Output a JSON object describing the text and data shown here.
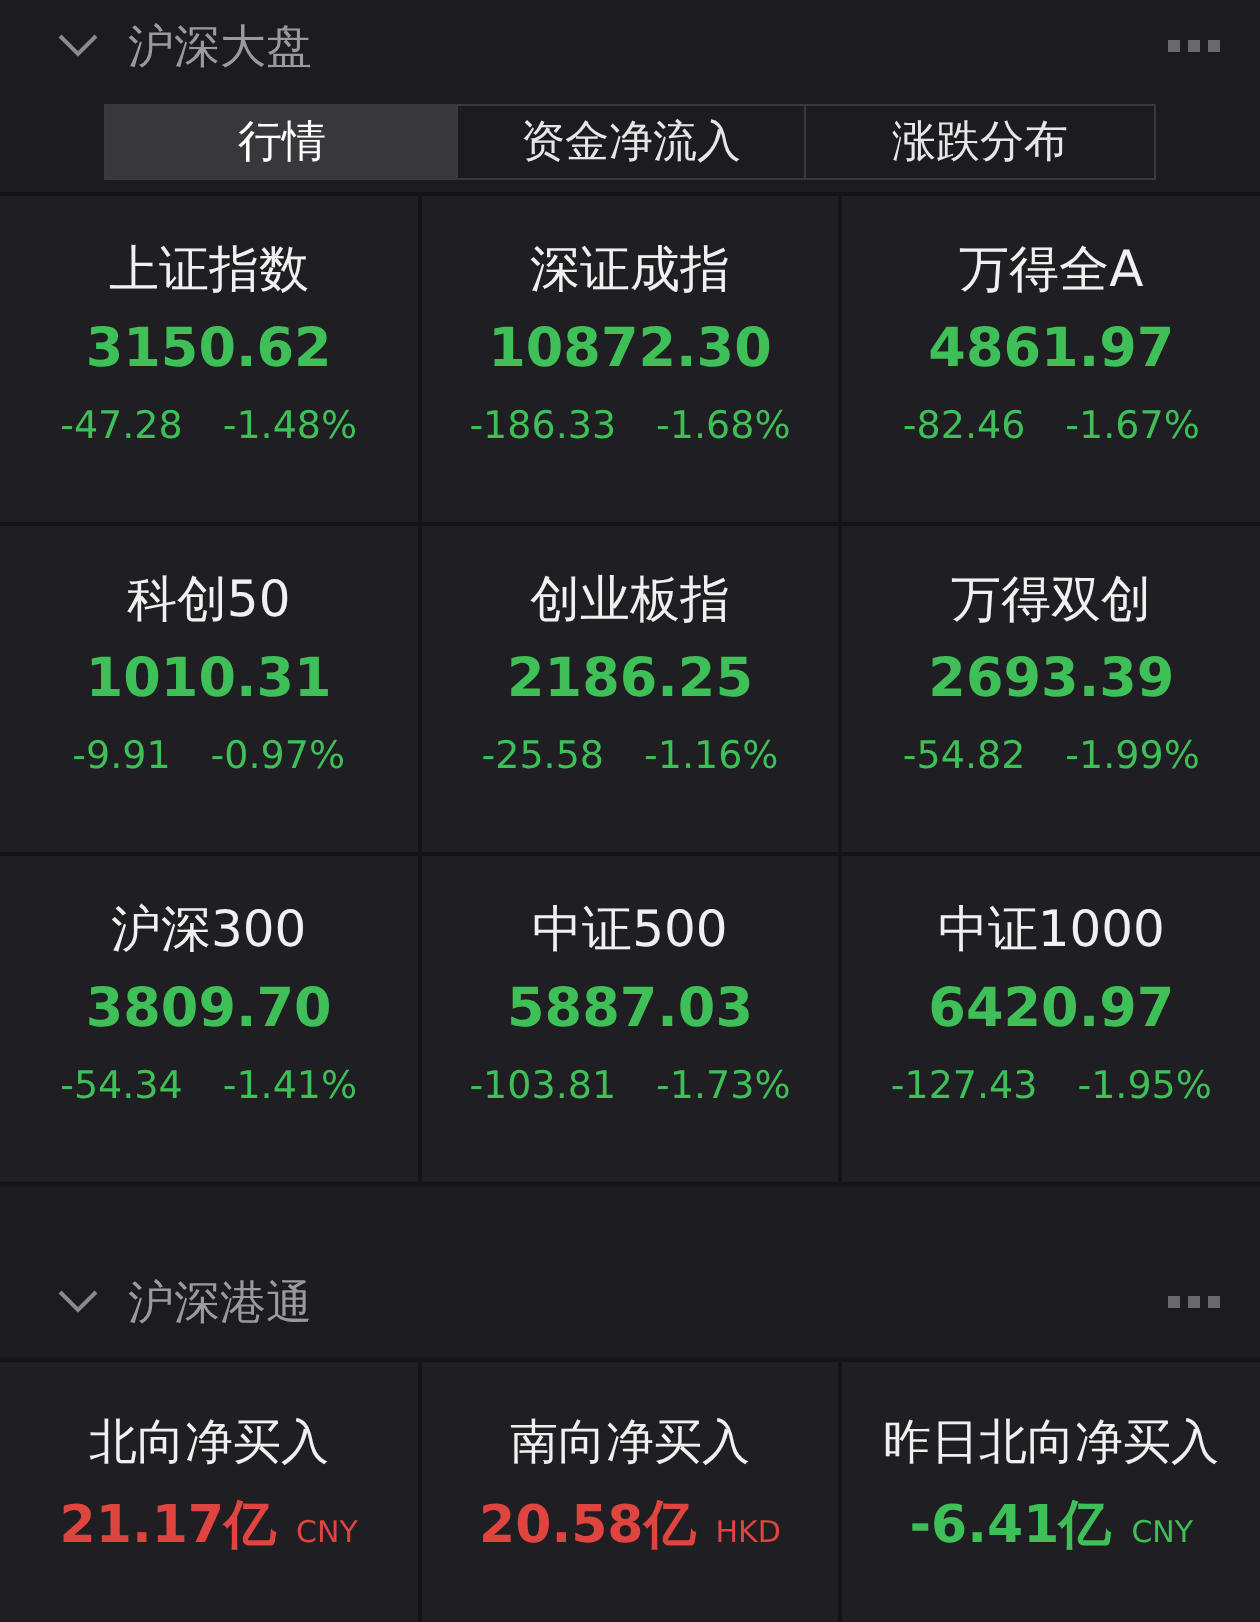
{
  "sections": [
    {
      "title": "沪深大盘",
      "expanded": true,
      "tabs": [
        {
          "label": "行情",
          "selected": true
        },
        {
          "label": "资金净流入",
          "selected": false
        },
        {
          "label": "涨跌分布",
          "selected": false
        }
      ],
      "indices": [
        {
          "name": "上证指数",
          "value": "3150.62",
          "change": "-47.28",
          "percent": "-1.48%",
          "color": "#3fbf57"
        },
        {
          "name": "深证成指",
          "value": "10872.30",
          "change": "-186.33",
          "percent": "-1.68%",
          "color": "#3fbf57"
        },
        {
          "name": "万得全A",
          "value": "4861.97",
          "change": "-82.46",
          "percent": "-1.67%",
          "color": "#3fbf57"
        },
        {
          "name": "科创50",
          "value": "1010.31",
          "change": "-9.91",
          "percent": "-0.97%",
          "color": "#3fbf57"
        },
        {
          "name": "创业板指",
          "value": "2186.25",
          "change": "-25.58",
          "percent": "-1.16%",
          "color": "#3fbf57"
        },
        {
          "name": "万得双创",
          "value": "2693.39",
          "change": "-54.82",
          "percent": "-1.99%",
          "color": "#3fbf57"
        },
        {
          "name": "沪深300",
          "value": "3809.70",
          "change": "-54.34",
          "percent": "-1.41%",
          "color": "#3fbf57"
        },
        {
          "name": "中证500",
          "value": "5887.03",
          "change": "-103.81",
          "percent": "-1.73%",
          "color": "#3fbf57"
        },
        {
          "name": "中证1000",
          "value": "6420.97",
          "change": "-127.43",
          "percent": "-1.95%",
          "color": "#3fbf57"
        }
      ]
    },
    {
      "title": "沪深港通",
      "expanded": true,
      "flows": [
        {
          "name": "北向净买入",
          "value": "21.17亿",
          "currency": "CNY",
          "color": "#e0443f"
        },
        {
          "name": "南向净买入",
          "value": "20.58亿",
          "currency": "HKD",
          "color": "#e0443f"
        },
        {
          "name": "昨日北向净买入",
          "value": "-6.41亿",
          "currency": "CNY",
          "color": "#3fbf57"
        }
      ]
    }
  ]
}
